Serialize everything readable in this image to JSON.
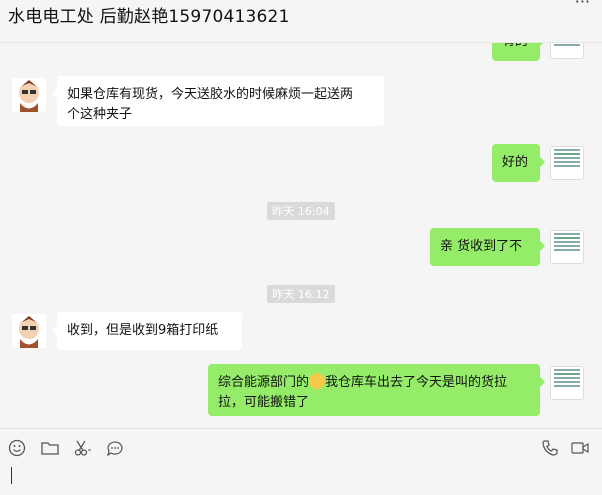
{
  "header": {
    "title": "水电电工处 后勤赵艳15970413621",
    "more_icon": "ellipsis-icon"
  },
  "messages": [
    {
      "id": "m0",
      "side": "out",
      "text": "有的"
    },
    {
      "id": "m1",
      "side": "in",
      "text_line1": "如果仓库有现货，今天送胶水的时候麻烦一起送两",
      "text_line2": "个这种夹子"
    },
    {
      "id": "m2",
      "side": "out",
      "text": "好的"
    },
    {
      "id": "t1",
      "time": "昨天 16:04"
    },
    {
      "id": "m3",
      "side": "out",
      "text": "亲 货收到了不"
    },
    {
      "id": "t2",
      "time": "昨天 16:12"
    },
    {
      "id": "m4",
      "side": "in",
      "text": "收到，但是收到9箱打印纸"
    },
    {
      "id": "m5",
      "side": "out",
      "text_line1a": "综合能源部门的",
      "text_line1b": "我仓库车出去了今天是叫的货拉",
      "text_line2": "拉，可能搬错了"
    }
  ],
  "toolbar": {
    "icons": [
      "emoji-icon",
      "folder-icon",
      "scissors-icon",
      "chat-bubble-icon",
      "phone-icon",
      "video-icon"
    ]
  },
  "colors": {
    "out_bubble": "#95ec69",
    "in_bubble": "#ffffff",
    "background": "#f5f5f5"
  }
}
